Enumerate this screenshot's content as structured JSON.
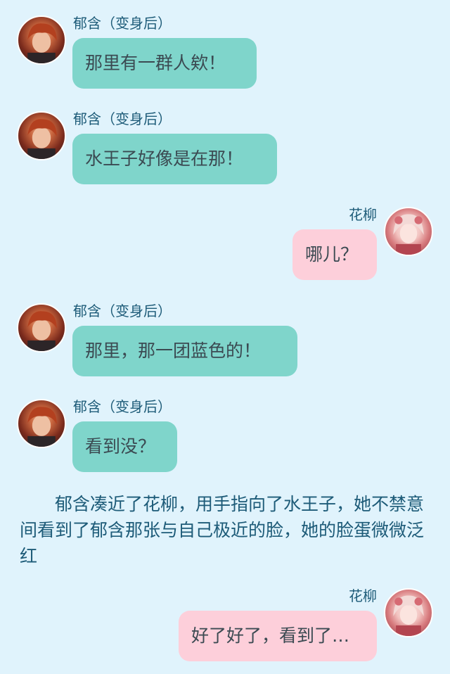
{
  "messages": [
    {
      "speaker": "郁含（变身后）",
      "text": "那里有一群人欸！",
      "side": "left",
      "avatar_icon": "yuhan-avatar-icon"
    },
    {
      "speaker": "郁含（变身后）",
      "text": "水王子好像是在那！",
      "side": "left",
      "avatar_icon": "yuhan-avatar-icon"
    },
    {
      "speaker": "花柳",
      "text": "哪儿？",
      "side": "right",
      "avatar_icon": "hualiu-avatar-icon"
    },
    {
      "speaker": "郁含（变身后）",
      "text": "那里，那一团蓝色的！",
      "side": "left",
      "avatar_icon": "yuhan-avatar-icon"
    },
    {
      "speaker": "郁含（变身后）",
      "text": "看到没？",
      "side": "left",
      "avatar_icon": "yuhan-avatar-icon"
    },
    {
      "speaker": "花柳",
      "text": "好了好了，看到了…",
      "side": "right",
      "avatar_icon": "hualiu-avatar-icon"
    }
  ],
  "narration": "郁含凑近了花柳，用手指向了水王子，她不禁意间看到了郁含那张与自己极近的脸，她的脸蛋微微泛红",
  "colors": {
    "background": "#e0f3fc",
    "left_bubble": "#7fd5cb",
    "right_bubble": "#fdcfda",
    "name_text": "#1d5b78"
  }
}
